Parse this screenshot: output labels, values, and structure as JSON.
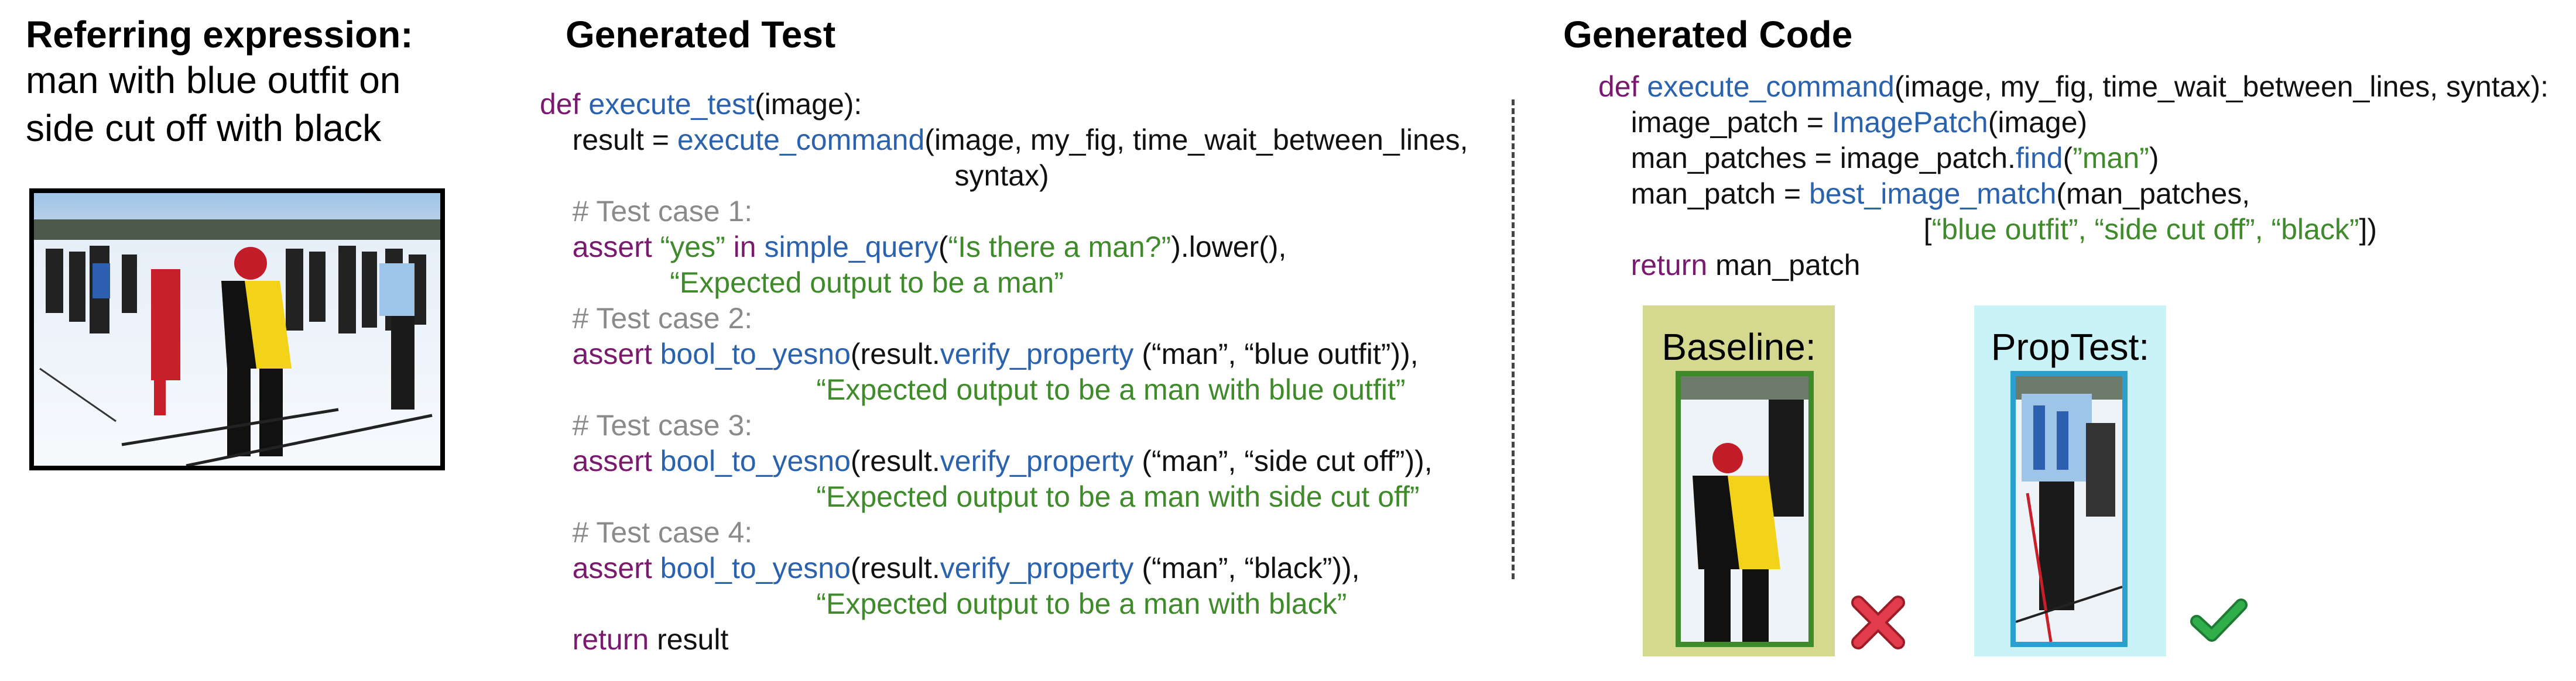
{
  "referring": {
    "heading": "Referring expression:",
    "lines": [
      "man with blue outfit on",
      "side cut off with black"
    ]
  },
  "test": {
    "heading": "Generated Test",
    "lines": [
      [
        {
          "t": "def ",
          "c": "kw"
        },
        {
          "t": "execute_test",
          "c": "fn"
        },
        {
          "t": "(image):",
          "c": ""
        }
      ],
      [
        {
          "t": "    result = ",
          "c": ""
        },
        {
          "t": "execute_command",
          "c": "fn"
        },
        {
          "t": "(image, my_fig, time_wait_between_lines,",
          "c": ""
        }
      ],
      [
        {
          "t": "                                                   syntax)",
          "c": ""
        }
      ],
      [
        {
          "t": "    # Test case 1:",
          "c": "cm"
        }
      ],
      [
        {
          "t": "    assert ",
          "c": "kw"
        },
        {
          "t": "“yes” ",
          "c": "str"
        },
        {
          "t": "in ",
          "c": "kw"
        },
        {
          "t": "simple_query",
          "c": "fn"
        },
        {
          "t": "(",
          "c": ""
        },
        {
          "t": "“Is there a man?”",
          "c": "str"
        },
        {
          "t": ").lower(),",
          "c": ""
        }
      ],
      [
        {
          "t": "                ",
          "c": ""
        },
        {
          "t": "“Expected output to be a man”",
          "c": "str"
        }
      ],
      [
        {
          "t": "    # Test case 2:",
          "c": "cm"
        }
      ],
      [
        {
          "t": "    assert ",
          "c": "kw"
        },
        {
          "t": "bool_to_yesno",
          "c": "fn"
        },
        {
          "t": "(result.",
          "c": ""
        },
        {
          "t": "verify_property",
          "c": "fn"
        },
        {
          "t": " (“man”, “blue outfit”)),",
          "c": ""
        }
      ],
      [
        {
          "t": "                                  ",
          "c": ""
        },
        {
          "t": "“Expected output to be a man with blue outfit”",
          "c": "str"
        }
      ],
      [
        {
          "t": "    # Test case 3:",
          "c": "cm"
        }
      ],
      [
        {
          "t": "    assert ",
          "c": "kw"
        },
        {
          "t": "bool_to_yesno",
          "c": "fn"
        },
        {
          "t": "(result.",
          "c": ""
        },
        {
          "t": "verify_property",
          "c": "fn"
        },
        {
          "t": " (“man”, “side cut off”)),",
          "c": ""
        }
      ],
      [
        {
          "t": "                                  ",
          "c": ""
        },
        {
          "t": "“Expected output to be a man with side cut off”",
          "c": "str"
        }
      ],
      [
        {
          "t": "    # Test case 4:",
          "c": "cm"
        }
      ],
      [
        {
          "t": "    assert ",
          "c": "kw"
        },
        {
          "t": "bool_to_yesno",
          "c": "fn"
        },
        {
          "t": "(result.",
          "c": ""
        },
        {
          "t": "verify_property",
          "c": "fn"
        },
        {
          "t": " (“man”, “black”)),",
          "c": ""
        }
      ],
      [
        {
          "t": "                                  ",
          "c": ""
        },
        {
          "t": "“Expected output to be a man with black”",
          "c": "str"
        }
      ],
      [
        {
          "t": "    return ",
          "c": "kw"
        },
        {
          "t": "result",
          "c": ""
        }
      ]
    ]
  },
  "code": {
    "heading": "Generated Code",
    "lines": [
      [
        {
          "t": "def ",
          "c": "kw"
        },
        {
          "t": "execute_command",
          "c": "fn"
        },
        {
          "t": "(image, my_fig, time_wait_between_lines, syntax):",
          "c": ""
        }
      ],
      [
        {
          "t": "    image_patch = ",
          "c": ""
        },
        {
          "t": "ImagePatch",
          "c": "fn"
        },
        {
          "t": "(image)",
          "c": ""
        }
      ],
      [
        {
          "t": "    man_patches = image_patch.",
          "c": ""
        },
        {
          "t": "find",
          "c": "fn"
        },
        {
          "t": "(",
          "c": ""
        },
        {
          "t": "”man”",
          "c": "str"
        },
        {
          "t": ")",
          "c": ""
        }
      ],
      [
        {
          "t": "    man_patch = ",
          "c": ""
        },
        {
          "t": "best_image_match",
          "c": "fn"
        },
        {
          "t": "(man_patches,",
          "c": ""
        }
      ],
      [
        {
          "t": "                                        [",
          "c": ""
        },
        {
          "t": "“blue outfit”, “side cut off”, “black”",
          "c": "str"
        },
        {
          "t": "])",
          "c": ""
        }
      ],
      [
        {
          "t": "    return ",
          "c": "kw"
        },
        {
          "t": "man_patch",
          "c": ""
        }
      ]
    ]
  },
  "results": {
    "baseline_label": "Baseline:",
    "proptest_label": "PropTest:",
    "baseline_mark": "cross-icon",
    "proptest_mark": "check-icon"
  },
  "colors": {
    "keyword": "#7a1a6e",
    "function": "#2b62ad",
    "string": "#3f8a2a",
    "comment": "#8a8a8a",
    "baseline_bg": "#d4d98f",
    "baseline_border": "#3e8a2a",
    "proptest_bg": "#c9f3f6",
    "proptest_border": "#2a9fd0",
    "cross": "#e23b4b",
    "check": "#2fae4a"
  }
}
